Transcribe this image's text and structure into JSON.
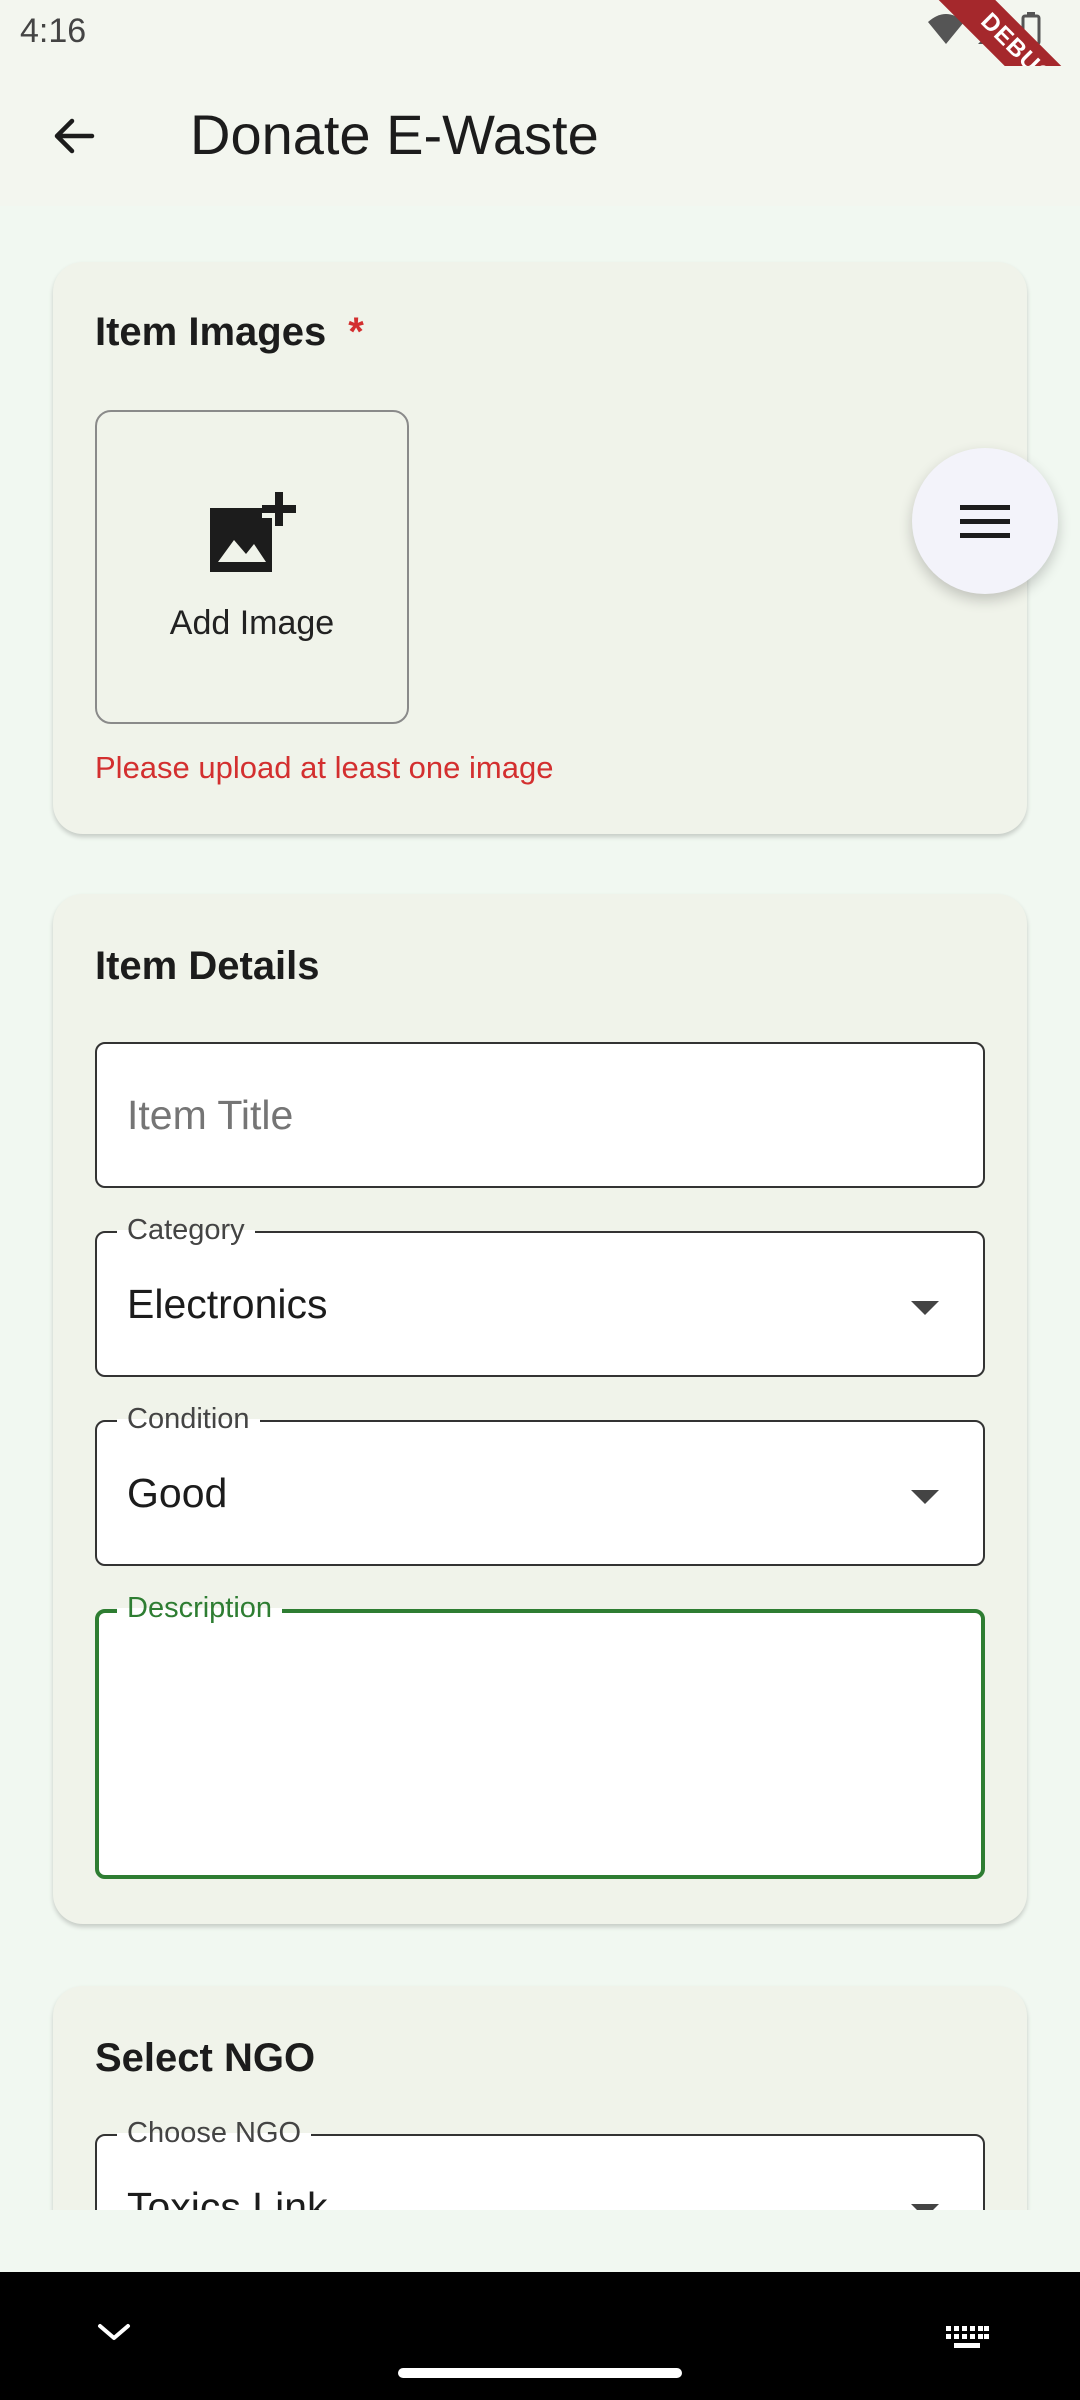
{
  "status_bar": {
    "time": "4:16",
    "debug_label": "DEBUG"
  },
  "app_bar": {
    "title": "Donate E-Waste"
  },
  "images_section": {
    "title": "Item Images",
    "required_mark": "*",
    "add_image_label": "Add Image",
    "error": "Please upload at least one image"
  },
  "details_section": {
    "title": "Item Details",
    "item_title_placeholder": "Item Title",
    "category": {
      "label": "Category",
      "value": "Electronics"
    },
    "condition": {
      "label": "Condition",
      "value": "Good"
    },
    "description": {
      "label": "Description",
      "value": ""
    }
  },
  "ngo_section": {
    "title": "Select NGO",
    "choose_ngo": {
      "label": "Choose NGO",
      "value": "Toxics Link"
    }
  },
  "colors": {
    "accent": "#2e7d32",
    "error": "#d32f2f",
    "card_bg": "#f0f3ea",
    "page_bg": "#f1f8f1"
  }
}
